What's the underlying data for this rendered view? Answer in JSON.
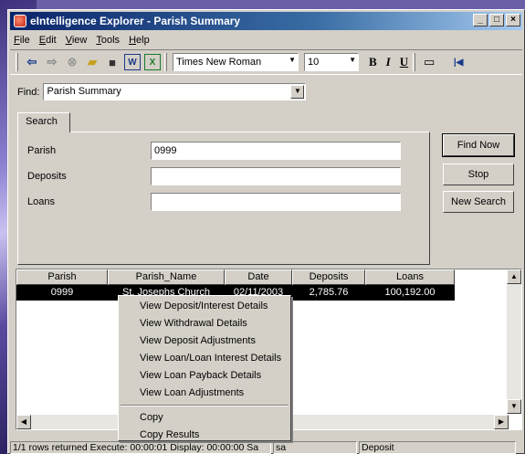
{
  "window": {
    "title": "eIntelligence Explorer - Parish Summary",
    "min": "_",
    "max": "□",
    "close": "×"
  },
  "menu": [
    "File",
    "Edit",
    "View",
    "Tools",
    "Help"
  ],
  "toolbar": {
    "font": "Times New Roman",
    "size": "10",
    "bold": "B",
    "italic": "I",
    "underline": "U"
  },
  "find": {
    "label": "Find:",
    "value": "Parish Summary"
  },
  "search_tab": "Search",
  "form": {
    "parish_label": "Parish",
    "parish_value": "0999",
    "deposits_label": "Deposits",
    "deposits_value": "",
    "loans_label": "Loans",
    "loans_value": ""
  },
  "buttons": {
    "find_now": "Find Now",
    "stop": "Stop",
    "new_search": "New Search"
  },
  "grid": {
    "columns": [
      "Parish",
      "Parish_Name",
      "Date",
      "Deposits",
      "Loans"
    ],
    "rows": [
      [
        "0999",
        "St. Josephs Church",
        "02/11/2003",
        "2,785.76",
        "100,192.00"
      ]
    ]
  },
  "context_menu": {
    "items": [
      "View Deposit/Interest Details",
      "View Withdrawal Details",
      "View Deposit Adjustments",
      "View Loan/Loan Interest Details",
      "View Loan Payback Details",
      "View Loan Adjustments"
    ],
    "items2": [
      "Copy",
      "Copy Results"
    ]
  },
  "status": {
    "left": "1/1 rows returned  Execute: 00:00:01  Display: 00:00:00 Sa",
    "user": "sa",
    "mode": "Deposit"
  },
  "colors": {
    "titlebar": "#0a246a",
    "face": "#d4d0c8",
    "selection": "#000000"
  }
}
